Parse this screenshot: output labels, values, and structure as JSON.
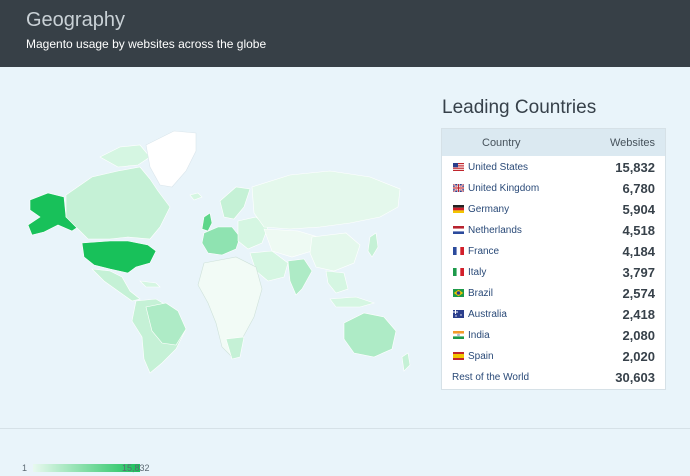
{
  "header": {
    "title": "Geography",
    "subtitle": "Magento usage by websites across the globe"
  },
  "map": {
    "legend_min": "1",
    "legend_max": "15,832",
    "colors": {
      "ocean": "#e9f4fa",
      "low": "#e8f9ef",
      "high": "#18c15a",
      "none": "#ffffff"
    }
  },
  "leading": {
    "title": "Leading Countries",
    "col_country": "Country",
    "col_websites": "Websites",
    "rows": [
      {
        "country": "United States",
        "websites": "15,832",
        "flag": "us-flag-icon"
      },
      {
        "country": "United Kingdom",
        "websites": "6,780",
        "flag": "uk-flag-icon"
      },
      {
        "country": "Germany",
        "websites": "5,904",
        "flag": "de-flag-icon"
      },
      {
        "country": "Netherlands",
        "websites": "4,518",
        "flag": "nl-flag-icon"
      },
      {
        "country": "France",
        "websites": "4,184",
        "flag": "fr-flag-icon"
      },
      {
        "country": "Italy",
        "websites": "3,797",
        "flag": "it-flag-icon"
      },
      {
        "country": "Brazil",
        "websites": "2,574",
        "flag": "br-flag-icon"
      },
      {
        "country": "Australia",
        "websites": "2,418",
        "flag": "au-flag-icon"
      },
      {
        "country": "India",
        "websites": "2,080",
        "flag": "in-flag-icon"
      },
      {
        "country": "Spain",
        "websites": "2,020",
        "flag": "es-flag-icon"
      }
    ],
    "rest": {
      "country": "Rest of the World",
      "websites": "30,603"
    }
  }
}
